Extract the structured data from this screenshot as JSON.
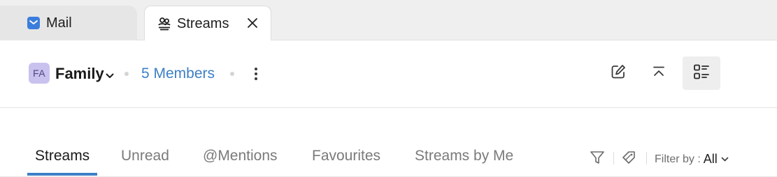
{
  "tabs": [
    {
      "label": "Mail",
      "icon": "mail-app-icon",
      "active": false
    },
    {
      "label": "Streams",
      "icon": "streams-icon",
      "active": true
    }
  ],
  "header": {
    "avatar_initials": "FA",
    "group_name": "Family",
    "members_link": "5 Members",
    "icons": [
      "compose-icon",
      "collapse-icon",
      "layout-view-icon"
    ]
  },
  "subtabs": [
    "Streams",
    "Unread",
    "@Mentions",
    "Favourites",
    "Streams by Me"
  ],
  "active_subtab": "Streams",
  "filter": {
    "prefix": "Filter by :",
    "value": "All"
  },
  "colors": {
    "accent": "#3d7fc6",
    "avatar_bg": "#c9c2ee",
    "mail_icon": "#3b7ddd"
  }
}
